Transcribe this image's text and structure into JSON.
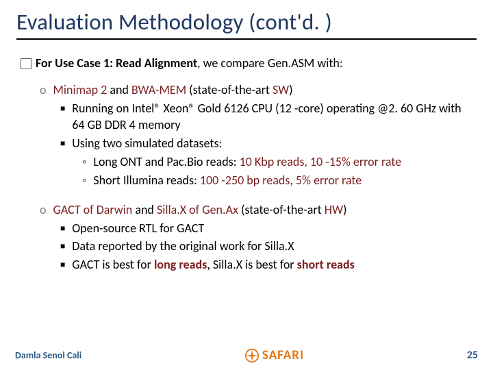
{
  "title": "Evaluation Methodology (cont'd. )",
  "line0_a": "For Use Case 1: Read Alignment",
  "line0_b": ", we compare Gen.ASM with:",
  "g1_head_a": "Minimap 2",
  "g1_head_b": " and ",
  "g1_head_c": "BWA-MEM",
  "g1_head_d": " (state-of-the-art ",
  "g1_head_e": "SW",
  "g1_head_f": ")",
  "g1_b1": "Running on Intel® Xeon® Gold 6126 CPU (12 -core) operating @2. 60 GHz with 64 GB DDR 4 memory",
  "g1_b2": "Using two simulated datasets:",
  "g1_s1_a": "Long ONT and Pac.Bio reads: ",
  "g1_s1_b": "10 Kbp reads, 10 -15% error rate",
  "g1_s2_a": "Short Illumina reads: ",
  "g1_s2_b": "100 -250 bp reads, 5% error rate",
  "g2_head_a": "GACT of Darwin",
  "g2_head_b": " and ",
  "g2_head_c": "Silla.X of Gen.Ax",
  "g2_head_d": " (state-of-the-art ",
  "g2_head_e": "HW",
  "g2_head_f": ")",
  "g2_b1": "Open-source RTL for GACT",
  "g2_b2": "Data reported by the original work for Silla.X",
  "g2_b3_a": "GACT is best for ",
  "g2_b3_b": "long reads",
  "g2_b3_c": ", Silla.X is best for ",
  "g2_b3_d": "short reads",
  "author": "Damla Senol Cali",
  "logo_text": "SAFARI",
  "page": "25"
}
